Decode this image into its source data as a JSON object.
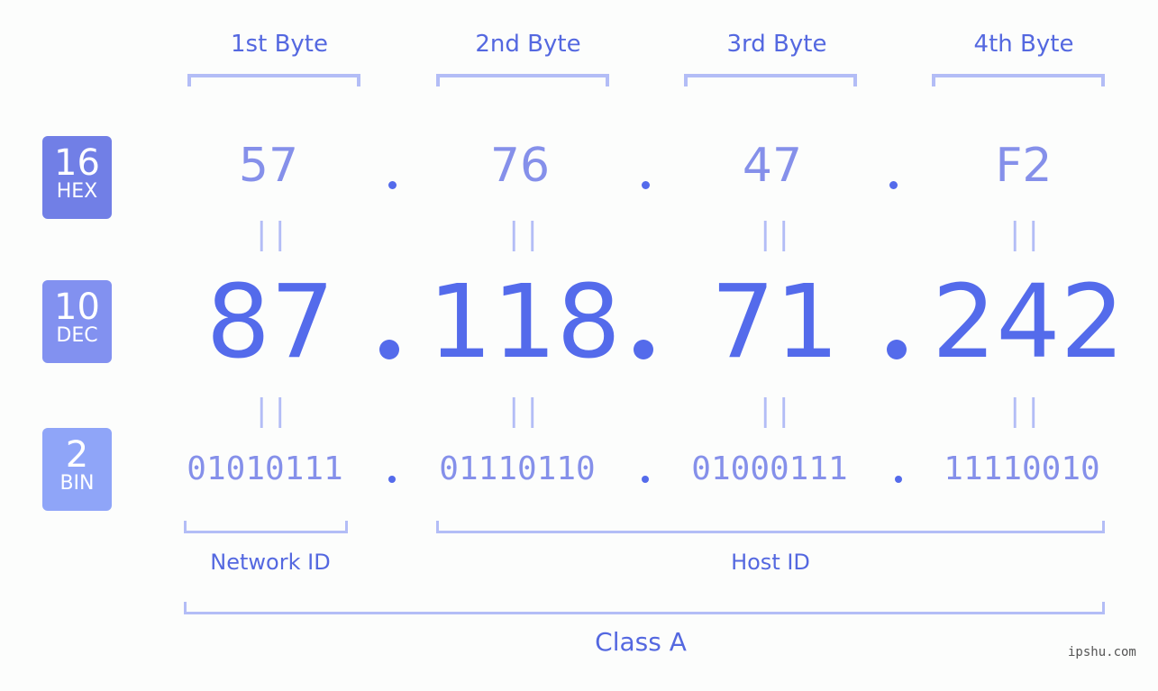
{
  "ip_address": "87.118.71.242",
  "colors": {
    "background": "#fcfdfc",
    "primary": "#546beb",
    "label_text": "#5468e0",
    "secondary_text": "#8590ea",
    "bracket": "#b3bdf6",
    "hex_badge": "#717fe6",
    "dec_badge": "#8291f0",
    "bin_badge": "#8fa5f8"
  },
  "badges": [
    {
      "base": "16",
      "label": "HEX"
    },
    {
      "base": "10",
      "label": "DEC"
    },
    {
      "base": "2",
      "label": "BIN"
    }
  ],
  "byte_headers": [
    "1st Byte",
    "2nd Byte",
    "3rd Byte",
    "4th Byte"
  ],
  "hex": [
    "57",
    "76",
    "47",
    "F2"
  ],
  "dec": [
    "87",
    "118",
    "71",
    "242"
  ],
  "bin": [
    "01010111",
    "01110110",
    "01000111",
    "11110010"
  ],
  "equals_symbol": "||",
  "segments": {
    "network_id": "Network ID",
    "host_id": "Host ID",
    "class": "Class A"
  },
  "watermark": "ipshu.com"
}
